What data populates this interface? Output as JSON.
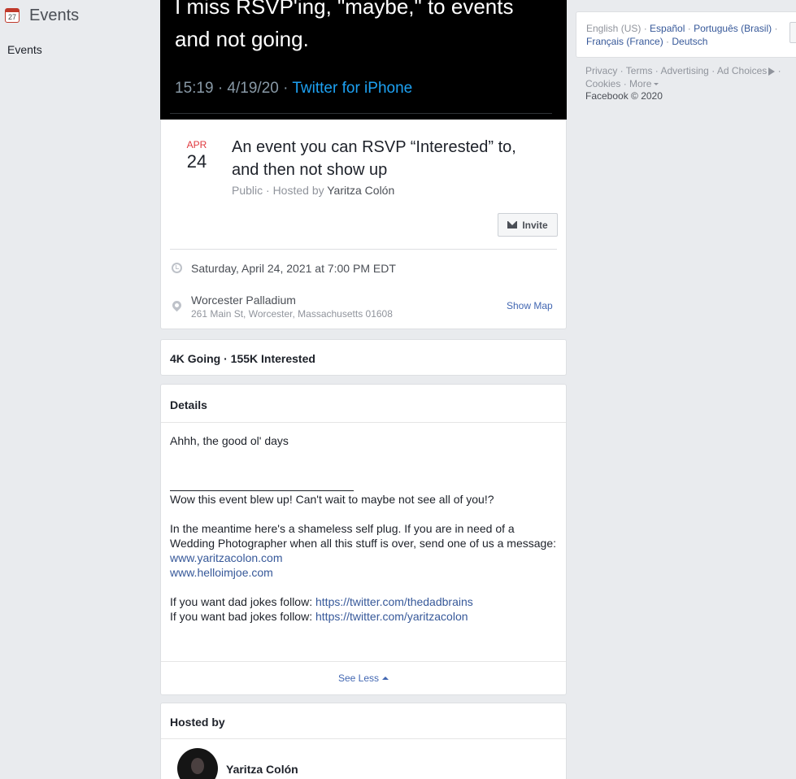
{
  "sidebar": {
    "title": "Events",
    "calendar_day": "27",
    "links": [
      "Events"
    ]
  },
  "tweet": {
    "text_line1": "I miss RSVP'ing, \"maybe,\" to events",
    "text_line2": "and not going.",
    "meta": "15:19 · 4/19/20 · ",
    "source": "Twitter for iPhone"
  },
  "event": {
    "month": "APR",
    "day": "24",
    "title": "An event you can RSVP “Interested” to, and then not show up",
    "privacy_prefix": "Public · Hosted by ",
    "host": "Yaritza Colón",
    "invite_label": "Invite",
    "datetime": "Saturday, April 24, 2021 at 7:00 PM EDT",
    "venue": "Worcester Palladium",
    "address": "261 Main St, Worcester, Massachusetts 01608",
    "show_map_label": "Show Map"
  },
  "stats": {
    "summary": "4K Going · 155K Interested"
  },
  "details": {
    "heading": "Details",
    "intro": "Ahhh, the good ol' days",
    "line_wow": "Wow this event blew up! Can't wait to maybe not see all of you!?",
    "plug_line1": "In the meantime here's a shameless self plug. If you are in need of a",
    "plug_line2": "Wedding Photographer when all this stuff is over, send one of us a message:",
    "link1": "www.yaritzacolon.com",
    "link2": "www.helloimjoe.com",
    "dad_prefix": "If you want dad jokes follow: ",
    "dad_link": "https://twitter.com/thedadbrains",
    "bad_prefix": "If you want bad jokes follow: ",
    "bad_link": "https://twitter.com/yaritzacolon",
    "see_less_label": "See Less"
  },
  "hosted": {
    "heading": "Hosted by",
    "name": "Yaritza Colón"
  },
  "languages": {
    "current": "English (US)",
    "others": [
      "Español",
      "Português (Brasil)",
      "Français (France)",
      "Deutsch"
    ]
  },
  "footer": {
    "links": [
      "Privacy",
      "Terms",
      "Advertising",
      "Ad Choices",
      "Cookies",
      "More"
    ],
    "copyright": "Facebook © 2020"
  },
  "colors": {
    "accent": "#4267b2",
    "date_red": "#e0393e",
    "background": "#e9ebee"
  }
}
